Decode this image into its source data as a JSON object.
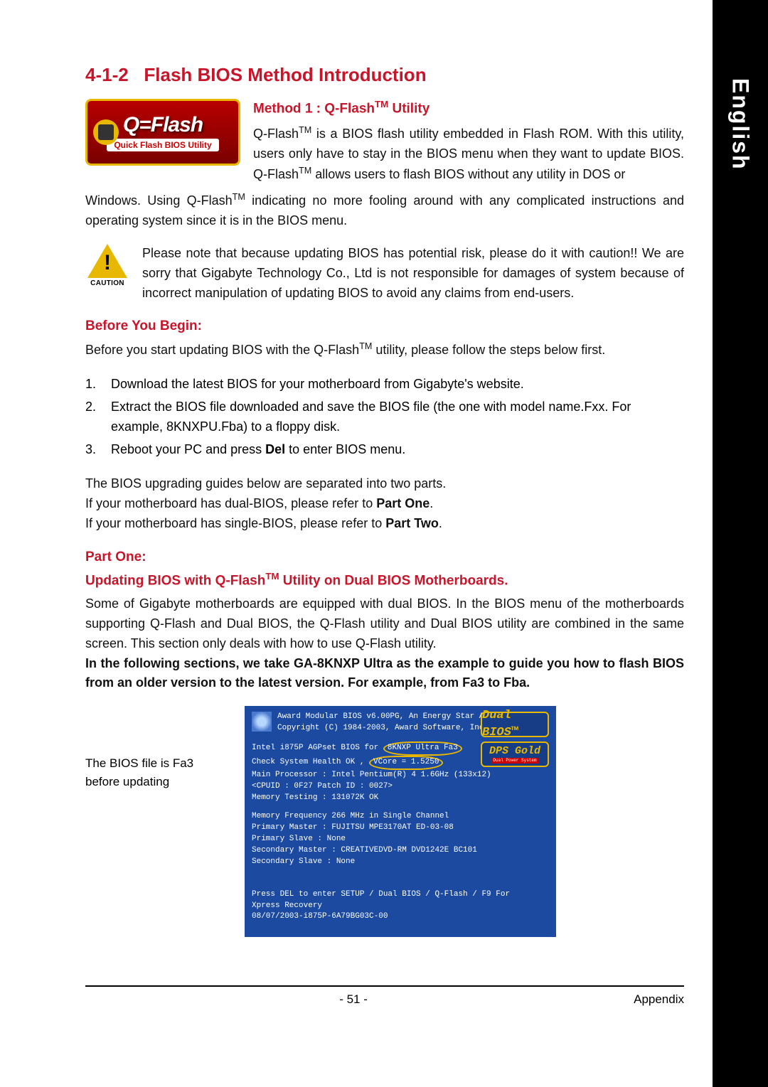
{
  "sideTab": "English",
  "section": {
    "number": "4-1-2",
    "title": "Flash BIOS Method Introduction"
  },
  "logo": {
    "main": "Q=Flash",
    "sub": "Quick Flash BIOS Utility"
  },
  "method1": {
    "title_prefix": "Method 1 : Q-Flash",
    "title_suffix": " Utility",
    "para_intro_a": "Q-Flash",
    "para_intro_b": " is a BIOS flash utility embedded in Flash ROM. With this utility, users only have to stay in the BIOS menu when they want to update BIOS. Q-Flash",
    "para_intro_c": " allows users to flash BIOS without any utility in DOS or",
    "para_cont_a": "Windows. Using Q-Flash",
    "para_cont_b": " indicating no more fooling around with any complicated instructions and operating system since it is in the BIOS menu."
  },
  "caution": {
    "label": "CAUTION",
    "text": "Please note that because updating BIOS has potential risk, please do it with caution!! We are sorry that Gigabyte Technology Co., Ltd is not responsible for damages of system because of incorrect manipulation of updating BIOS to avoid any claims from end-users."
  },
  "before": {
    "heading": "Before You Begin:",
    "intro_a": "Before you start updating BIOS with the Q-Flash",
    "intro_b": " utility, please follow the steps below first.",
    "items": [
      "Download the latest BIOS for your motherboard from Gigabyte's website.",
      "Extract the BIOS file downloaded and save the BIOS file (the one with model name.Fxx. For example, 8KNXPU.Fba) to a floppy disk.",
      "Reboot your PC and press Del to enter BIOS menu."
    ],
    "note_a": "The BIOS upgrading guides below are separated into two parts.",
    "note_b_pre": "If your motherboard has dual-BIOS, please refer to ",
    "note_b_bold": "Part One",
    "note_c_pre": "If your motherboard has single-BIOS, please refer to ",
    "note_c_bold": "Part Two"
  },
  "partOne": {
    "heading": "Part One:",
    "sub_pre": "Updating BIOS with Q-Flash",
    "sub_post": " Utility on Dual BIOS Motherboards.",
    "para": "Some of Gigabyte motherboards are equipped with dual BIOS. In the BIOS menu of the motherboards supporting Q-Flash and Dual BIOS, the Q-Flash utility and Dual BIOS utility are combined in the same screen. This section only deals with how to use Q-Flash utility.",
    "bold": "In the following sections, we take GA-8KNXP Ultra as the example to guide you how to flash BIOS from an older version to the latest version. For example, from Fa3 to Fba."
  },
  "biosNote": "The BIOS file is Fa3 before updating",
  "bios": {
    "l1": "Award Modular BIOS v6.00PG, An Energy Star Ally",
    "l2": "Copyright (C) 1984-2003, Award Software, Inc.",
    "l3a": "Intel i875P AGPset BIOS for",
    "l3b": "8KNXP Ultra Fa3",
    "l4a": "Check System Health OK ,",
    "l4b": "VCore = 1.5250",
    "l5": "Main Processor : Intel Pentium(R) 4  1.6GHz (133x12)",
    "l6": "<CPUID : 0F27 Patch ID : 0027>",
    "l7": "Memory Testing  : 131072K OK",
    "l8": "Memory Frequency 266 MHz in Single Channel",
    "l9": "Primary Master : FUJITSU MPE3170AT ED-03-08",
    "l10": "Primary Slave : None",
    "l11": "Secondary Master : CREATIVEDVD-RM DVD1242E BC101",
    "l12": "Secondary Slave : None",
    "l13": "Press DEL to enter SETUP / Dual BIOS / Q-Flash / F9 For",
    "l14": "Xpress Recovery",
    "l15": "08/07/2003-i875P-6A79BG03C-00",
    "badgeDual": "Dual BIOS™",
    "badgeDps": "DPS Gold",
    "badgeDpsSub": "Dual Power System"
  },
  "footer": {
    "page": "- 51 -",
    "section": "Appendix"
  }
}
